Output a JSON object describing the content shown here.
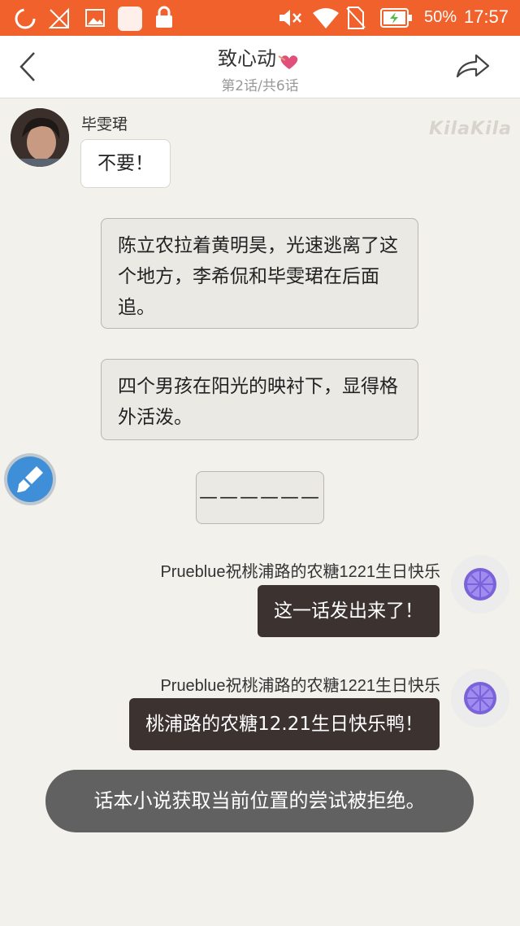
{
  "status_bar": {
    "battery": "50%",
    "time": "17:57",
    "icons": [
      "loading-ring-icon",
      "no-signal-icon",
      "image-icon",
      "app-square-icon",
      "lock-icon",
      "mute-icon",
      "wifi-icon",
      "no-sim-icon",
      "battery-icon"
    ]
  },
  "header": {
    "title": "致心动",
    "subtitle": "第2话/共6话"
  },
  "watermark": "KilaKila",
  "messages": {
    "left": {
      "name": "毕雯珺",
      "text": "不要！"
    },
    "narration1": "陈立农拉着黄明昊，光速逃离了这个地方，李希侃和毕雯珺在后面追。",
    "narration2": "四个男孩在阳光的映衬下，显得格外活泼。",
    "narration3": "——————",
    "right1": {
      "name": "Prueblue祝桃浦路的农糖1221生日快乐",
      "text": "这一话发出来了！"
    },
    "right2": {
      "name": "Prueblue祝桃浦路的农糖1221生日快乐",
      "text": "桃浦路的农糖12.21生日快乐鸭！"
    }
  },
  "toast": "话本小说获取当前位置的尝试被拒绝。",
  "colors": {
    "status_bar": "#f0612c",
    "background": "#f3f1ec",
    "dark_bubble": "#3c3230",
    "toast": "#616161"
  }
}
